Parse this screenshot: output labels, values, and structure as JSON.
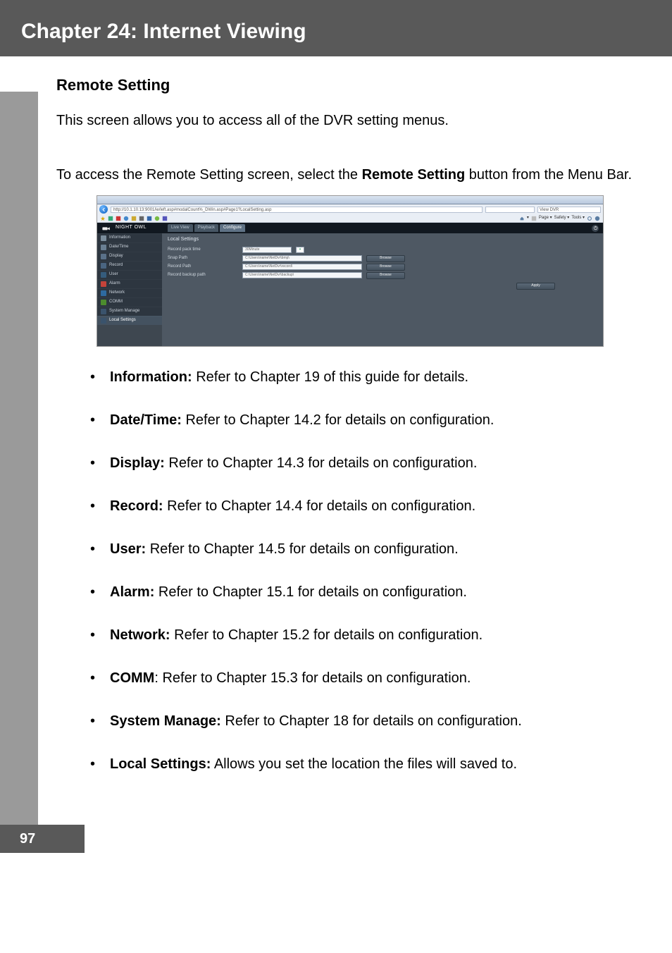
{
  "chapter_title": "Chapter 24: Internet Viewing",
  "section_title": "Remote Setting",
  "intro_paragraph_1": "This screen allows you to access all of the DVR setting menus.",
  "intro_paragraph_2_pre": "To access the Remote Setting screen, select the ",
  "intro_paragraph_2_strong": "Remote Setting",
  "intro_paragraph_2_post": " button from the Menu Bar.",
  "page_number": "97",
  "screenshot": {
    "url": "http://10.1.10.13:9001/ie/left.asp#modalCount%_DWin.asp#Page1?LocalSetting.asp",
    "page_tab": "View DVR",
    "ie_menu": [
      "Page ▾",
      "Safety ▾",
      "Tools ▾"
    ],
    "brand": "NIGHT OWL",
    "tabs": {
      "live": "Live View",
      "playback": "Playback",
      "configure": "Configure"
    },
    "power_icon": "power-icon",
    "sidebar": {
      "items": [
        {
          "label": "Information",
          "color": "#7b8d9c"
        },
        {
          "label": "Date/Time",
          "color": "#6a7f93"
        },
        {
          "label": "Display",
          "color": "#5a7189"
        },
        {
          "label": "Record",
          "color": "#4a6581"
        },
        {
          "label": "User",
          "color": "#355c7d"
        },
        {
          "label": "Alarm",
          "color": "#c4433a"
        },
        {
          "label": "Network",
          "color": "#2e6aa0"
        },
        {
          "label": "COMM",
          "color": "#4c8c2e"
        },
        {
          "label": "System Manage",
          "color": "#3a536c"
        },
        {
          "label": "Local Settings",
          "color": "#3a536c",
          "selected": true
        }
      ]
    },
    "panel": {
      "title": "Local Settings",
      "rows": [
        {
          "label": "Record pack time",
          "value": "30Minute",
          "type": "select"
        },
        {
          "label": "Snap Path",
          "value": "C:\\Users\\name\\NetDvr\\bmp\\",
          "type": "path"
        },
        {
          "label": "Record Path",
          "value": "C:\\Users\\name\\NetDvr\\record\\",
          "type": "path"
        },
        {
          "label": "Record backup path",
          "value": "C:\\Users\\name\\NetDvr\\backup\\",
          "type": "path"
        }
      ],
      "browse_label": "Browse",
      "apply_label": "Apply"
    }
  },
  "bullets": [
    {
      "term": "Information:",
      "desc": " Refer to Chapter 19 of this guide for details."
    },
    {
      "term": "Date/Time:",
      "desc": " Refer to Chapter 14.2 for details on configuration."
    },
    {
      "term": "Display:",
      "desc": " Refer to Chapter 14.3 for details on configuration."
    },
    {
      "term": "Record:",
      "desc": " Refer to Chapter 14.4 for details on configuration."
    },
    {
      "term": "User:",
      "desc": " Refer to Chapter 14.5 for details on configuration."
    },
    {
      "term": "Alarm:",
      "desc": " Refer to Chapter 15.1 for details on configuration."
    },
    {
      "term": "Network:",
      "desc": " Refer to Chapter 15.2 for details on configuration."
    },
    {
      "term": "COMM",
      "desc": ": Refer to Chapter 15.3 for details on configuration."
    },
    {
      "term": "System Manage:",
      "desc": " Refer to Chapter 18 for details on configuration."
    },
    {
      "term": "Local Settings:",
      "desc": " Allows you set the location the files will saved to."
    }
  ]
}
